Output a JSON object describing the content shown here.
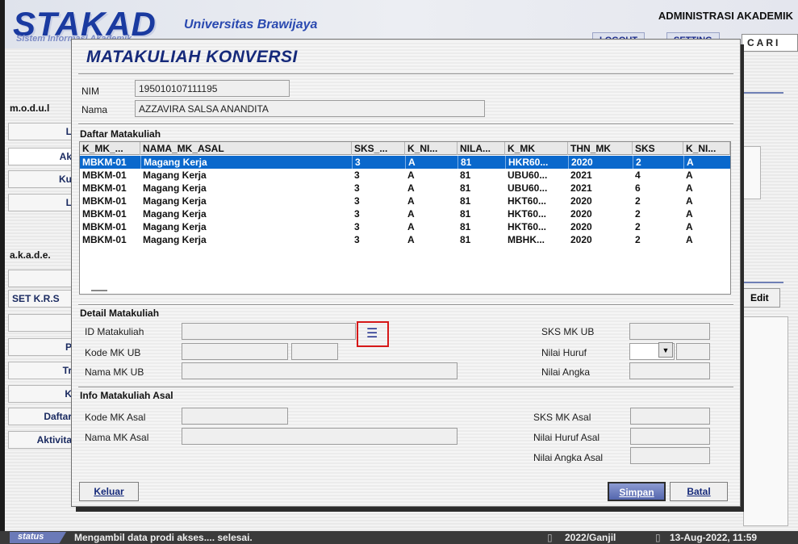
{
  "app": {
    "logo": "STAKAD",
    "university": "Universitas Brawijaya",
    "subtitle": "Sistem Informasi Akademik",
    "admin_label": "ADMINISTRASI AKADEMIK",
    "nav": {
      "logout": "LOGOUT",
      "setting": "SETTING",
      "search": "CARI"
    }
  },
  "sidebar": {
    "modul_label": "m.o.d.u.l",
    "akademik_label": "a.k.a.d.e.",
    "items": [
      "L",
      "Ak",
      "Ku",
      "L",
      "",
      "SET K.R.S",
      "",
      "P",
      "Tr",
      "K",
      "Daftar",
      "Aktivita"
    ]
  },
  "background": {
    "edit_button": "Edit"
  },
  "dialog": {
    "title": "MATAKULIAH KONVERSI",
    "nim_label": "NIM",
    "nim_value": "195010107111195",
    "nama_label": "Nama",
    "nama_value": "AZZAVIRA SALSA ANANDITA",
    "list_section": "Daftar Matakuliah",
    "columns": [
      "K_MK_...",
      "NAMA_MK_ASAL",
      "SKS_...",
      "K_NI...",
      "NILA...",
      "K_MK",
      "THN_MK",
      "SKS",
      "K_NI..."
    ],
    "rows": [
      [
        "MBKM-01",
        "Magang Kerja",
        "3",
        "A",
        "81",
        "HKR60...",
        "2020",
        "2",
        "A"
      ],
      [
        "MBKM-01",
        "Magang Kerja",
        "3",
        "A",
        "81",
        "UBU60...",
        "2021",
        "4",
        "A"
      ],
      [
        "MBKM-01",
        "Magang Kerja",
        "3",
        "A",
        "81",
        "UBU60...",
        "2021",
        "6",
        "A"
      ],
      [
        "MBKM-01",
        "Magang Kerja",
        "3",
        "A",
        "81",
        "HKT60...",
        "2020",
        "2",
        "A"
      ],
      [
        "MBKM-01",
        "Magang Kerja",
        "3",
        "A",
        "81",
        "HKT60...",
        "2020",
        "2",
        "A"
      ],
      [
        "MBKM-01",
        "Magang Kerja",
        "3",
        "A",
        "81",
        "HKT60...",
        "2020",
        "2",
        "A"
      ],
      [
        "MBKM-01",
        "Magang Kerja",
        "3",
        "A",
        "81",
        "MBHK...",
        "2020",
        "2",
        "A"
      ]
    ],
    "selected_row": 0,
    "detail_section": "Detail Matakuliah",
    "detail": {
      "id_label": "ID Matakuliah",
      "kode_label": "Kode MK UB",
      "nama_label": "Nama MK UB",
      "sks_label": "SKS MK UB",
      "huruf_label": "Nilai Huruf",
      "angka_label": "Nilai Angka"
    },
    "info_section": "Info Matakuliah Asal",
    "info": {
      "kode_label": "Kode MK Asal",
      "nama_label": "Nama MK Asal",
      "sks_label": "SKS MK Asal",
      "huruf_label": "Nilai Huruf Asal",
      "angka_label": "Nilai Angka Asal"
    },
    "buttons": {
      "keluar": "Keluar",
      "simpan": "Simpan",
      "batal": "Batal"
    },
    "icons": {
      "lookup": "list-icon",
      "dropdown": "chevron-down-icon"
    }
  },
  "status": {
    "tag": "status",
    "message": "Mengambil data prodi akses.... selesai.",
    "period": "2022/Ganjil",
    "datetime": "13-Aug-2022, 11:59"
  },
  "colors": {
    "selection": "#0a68cc",
    "brand": "#15297a",
    "highlight_box": "#d61818"
  }
}
